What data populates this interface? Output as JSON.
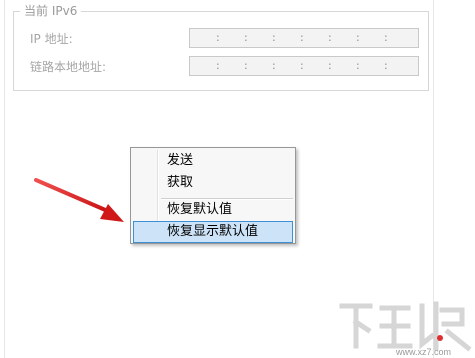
{
  "ipv6_group": {
    "title": "当前 IPv6",
    "ip_label": "IP 地址:",
    "link_local_label": "链路本地地址:",
    "separator": ":"
  },
  "context_menu": {
    "items": [
      {
        "label": "发送"
      },
      {
        "label": "获取"
      },
      {
        "label": "恢复默认值"
      },
      {
        "label": "恢复显示默认值",
        "highlighted": true
      }
    ]
  },
  "watermark": {
    "url": "www.xz7.com"
  },
  "colors": {
    "arrow": "#e02020",
    "menu_highlight": "#cde3f7",
    "menu_highlight_border": "#3d8fd6"
  }
}
